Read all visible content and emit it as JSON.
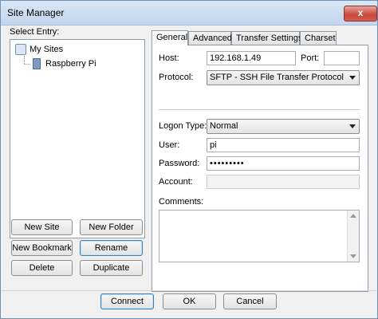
{
  "window": {
    "title": "Site Manager",
    "close_glyph": "x"
  },
  "tree": {
    "label": "Select Entry:",
    "root": "My Sites",
    "child": "Raspberry Pi"
  },
  "left_buttons": {
    "new_site": "New Site",
    "new_folder": "New Folder",
    "new_bookmark": "New Bookmark",
    "rename": "Rename",
    "delete": "Delete",
    "duplicate": "Duplicate"
  },
  "tabs": [
    "General",
    "Advanced",
    "Transfer Settings",
    "Charset"
  ],
  "general": {
    "host_label": "Host:",
    "host_value": "192.168.1.49",
    "port_label": "Port:",
    "port_value": "",
    "protocol_label": "Protocol:",
    "protocol_value": "SFTP - SSH File Transfer Protocol",
    "logon_label": "Logon Type:",
    "logon_value": "Normal",
    "user_label": "User:",
    "user_value": "pi",
    "password_label": "Password:",
    "password_value": "•••••••••",
    "account_label": "Account:",
    "account_value": "",
    "comments_label": "Comments:"
  },
  "footer": {
    "connect": "Connect",
    "ok": "OK",
    "cancel": "Cancel"
  },
  "icons": {
    "root": "folder-icon",
    "child": "computer-icon",
    "close": "close-icon"
  }
}
